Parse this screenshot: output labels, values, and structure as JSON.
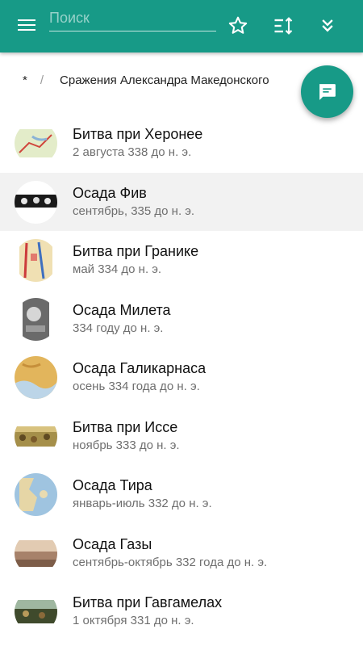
{
  "search": {
    "placeholder": "Поиск"
  },
  "breadcrumb": {
    "home": "*",
    "separator": "/",
    "current": "Сражения Александра Македонского"
  },
  "colors": {
    "accent": "#179a87",
    "selected_row": "#f2f2f2"
  },
  "items": [
    {
      "title": "Битва при Херонее",
      "date": "2 августа 338 до н. э."
    },
    {
      "title": "Осада Фив",
      "date": "сентябрь, 335 до н. э."
    },
    {
      "title": "Битва при Гранике",
      "date": "май 334 до н. э."
    },
    {
      "title": "Осада Милета",
      "date": "334 году до н. э."
    },
    {
      "title": "Осада Галикарнаса",
      "date": "осень 334 года до н. э."
    },
    {
      "title": "Битва при Иссе",
      "date": "ноябрь 333 до н. э."
    },
    {
      "title": "Осада Тира",
      "date": "январь-июль 332 до н. э."
    },
    {
      "title": "Осада Газы",
      "date": "сентябрь-октябрь 332 года до н. э."
    },
    {
      "title": "Битва при Гавгамелах",
      "date": "1 октября 331 до н. э."
    }
  ]
}
